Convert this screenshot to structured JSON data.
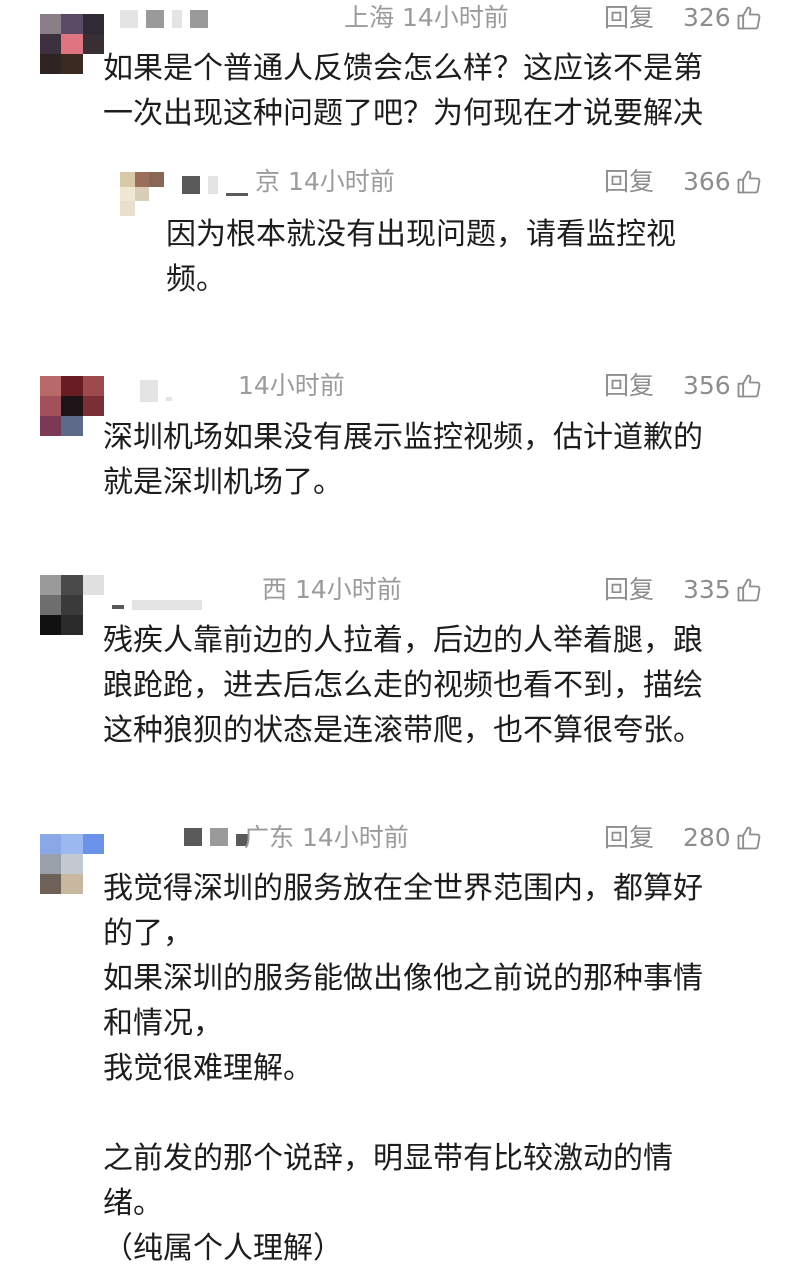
{
  "comments": [
    {
      "location_time": "上海 14小时前",
      "reply_label": "回复",
      "likes": "326",
      "text": "如果是个普通人反馈会怎么样？这应该不是第\n一次出现这种问题了吧？为何现在才说要解决"
    },
    {
      "location_time": "京 14小时前",
      "reply_label": "回复",
      "likes": "366",
      "text": "因为根本就没有出现问题，请看监控视\n频。"
    },
    {
      "location_time": "14小时前",
      "reply_label": "回复",
      "likes": "356",
      "text": "深圳机场如果没有展示监控视频，估计道歉的\n就是深圳机场了。"
    },
    {
      "location_time": "西 14小时前",
      "reply_label": "回复",
      "likes": "335",
      "text": "残疾人靠前边的人拉着，后边的人举着腿，踉\n踉跄跄，进去后怎么走的视频也看不到，描绘\n这种狼狈的状态是连滚带爬，也不算很夸张。"
    },
    {
      "location_time": "广东 14小时前",
      "reply_label": "回复",
      "likes": "280",
      "text": "我觉得深圳的服务放在全世界范围内，都算好\n的了，\n如果深圳的服务能做出像他之前说的那种事情\n和情况，\n我觉很难理解。\n\n之前发的那个说辞，明显带有比较激动的情\n绪。\n（纯属个人理解）"
    }
  ],
  "icons": {
    "like": "thumbs-up-outline-icon"
  }
}
